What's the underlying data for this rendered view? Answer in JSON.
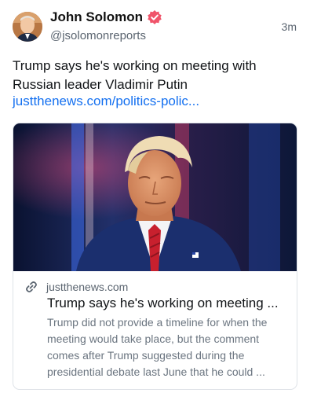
{
  "author": {
    "display_name": "John Solomon",
    "handle": "@jsolomonreports",
    "avatar_icon": "avatar-photo",
    "verified_icon": "verified-badge-icon",
    "verified_color": "#f0546a"
  },
  "post": {
    "timestamp": "3m",
    "text": "Trump says he's working on meeting with Russian leader Vladimir Putin",
    "link_text": "justthenews.com/politics-polic..."
  },
  "card": {
    "image_icon": "article-photo",
    "link_icon": "link-icon",
    "domain": "justthenews.com",
    "title": "Trump says he's working on meeting ...",
    "description": "Trump did not provide a timeline for when the meeting would take place, but the comment comes after Trump suggested during the presidential debate last June that he could ..."
  },
  "colors": {
    "link": "#1470f0",
    "muted_text": "#5b6570",
    "card_border": "#dfe3e8"
  }
}
